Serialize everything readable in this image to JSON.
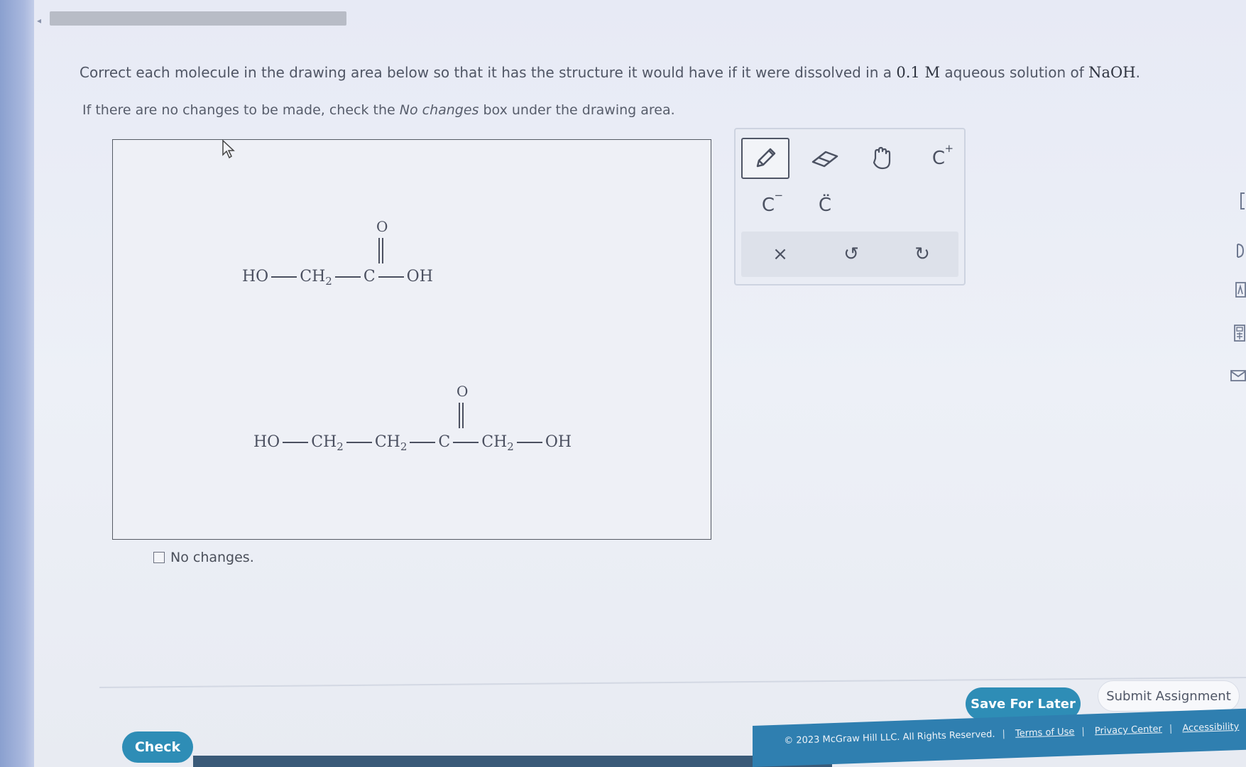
{
  "instructions": {
    "line1_prefix": "Correct each molecule in the drawing area below so that it has the structure it would have if it were dissolved in a ",
    "concentration": "0.1 M",
    "line1_middle": " aqueous solution of ",
    "reagent": "NaOH",
    "line1_suffix": ".",
    "line2_prefix": "If there are no changes to be made, check the ",
    "line2_emphasis": "No changes",
    "line2_suffix": " box under the drawing area."
  },
  "molecules": {
    "m1": {
      "ho": "HO",
      "ch": "CH",
      "sub2": "2",
      "c": "C",
      "oh": "OH",
      "o": "O"
    },
    "m2": {
      "ho": "HO",
      "ch_a": "CH",
      "sub_a": "2",
      "ch_b": "CH",
      "sub_b": "2",
      "c": "C",
      "ch_c": "CH",
      "sub_c": "2",
      "oh": "OH",
      "o": "O"
    }
  },
  "no_changes_label": "No changes.",
  "toolbox": {
    "tools": [
      "pencil-icon",
      "eraser-icon",
      "hand-icon",
      "carbocation",
      "carbanion",
      "carbene",
      "clear",
      "undo",
      "redo"
    ],
    "carbocation_label": "C",
    "carbocation_sup": "+",
    "carbanion_label": "C",
    "carbanion_sup": "−",
    "carbene_label": "C̈",
    "clear_label": "×",
    "undo_label": "↺",
    "redo_label": "↻"
  },
  "buttons": {
    "save": "Save For Later",
    "submit": "Submit Assignment",
    "check": "Check"
  },
  "footer": {
    "copyright": "© 2023 McGraw Hill LLC. All Rights Reserved.",
    "terms": "Terms of Use",
    "privacy": "Privacy Center",
    "accessibility": "Accessibility"
  },
  "colors": {
    "accent": "#2e8db6",
    "footer_bar": "#2f7fb0"
  }
}
